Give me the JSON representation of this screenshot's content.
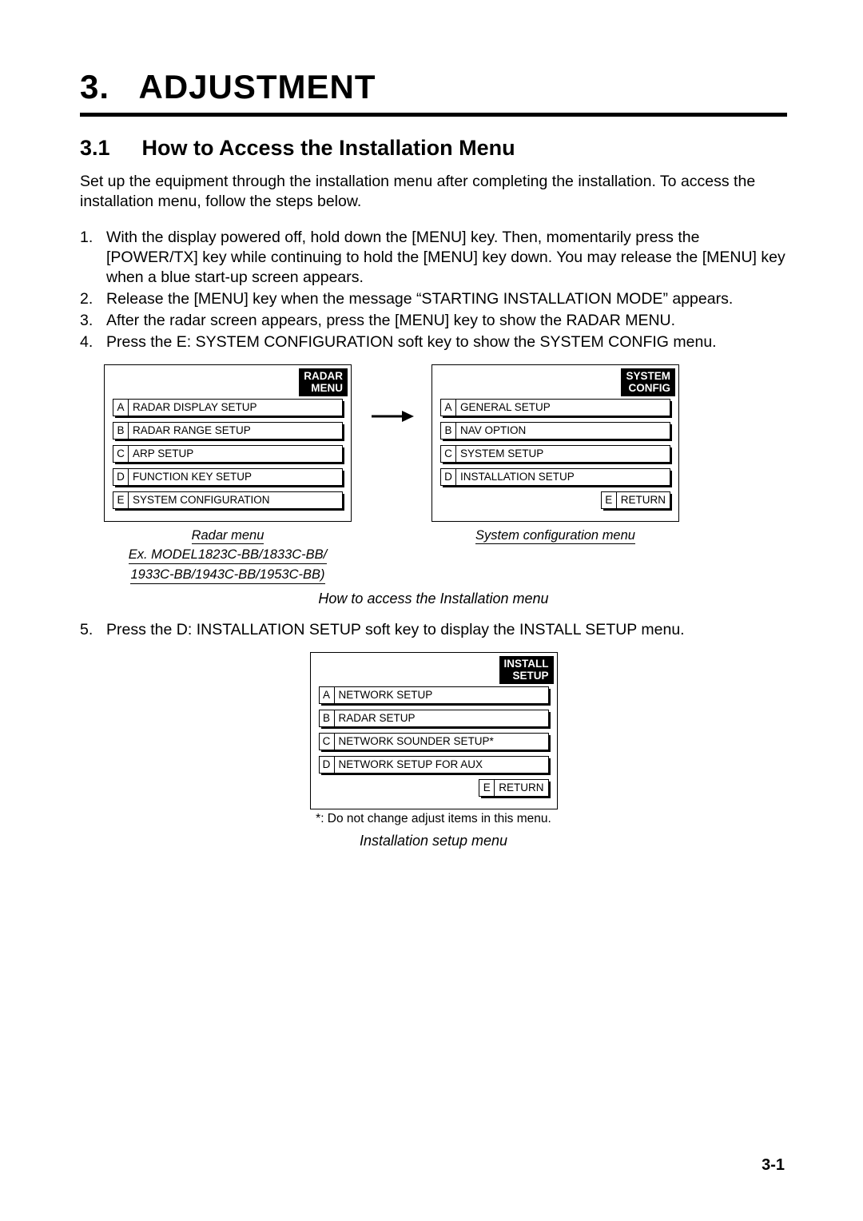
{
  "chapter": {
    "number": "3.",
    "title": "ADJUSTMENT"
  },
  "section": {
    "number": "3.1",
    "title": "How to Access the Installation Menu"
  },
  "intro": "Set up the equipment through the installation menu after completing the installation. To access the installation menu, follow the steps below.",
  "steps": [
    "With the display powered off, hold down the [MENU] key. Then, momentarily press the [POWER/TX] key while continuing to hold the [MENU] key down. You may release the [MENU] key when a blue start-up screen appears.",
    "Release the [MENU] key when the message “STARTING INSTALLATION MODE” appears.",
    "After the radar screen appears, press the [MENU] key to show the RADAR MENU.",
    "Press the E: SYSTEM CONFIGURATION soft key to show the SYSTEM CONFIG menu."
  ],
  "menu1": {
    "title1": "RADAR",
    "title2": "MENU",
    "items": [
      {
        "k": "A",
        "l": "RADAR DISPLAY SETUP"
      },
      {
        "k": "B",
        "l": "RADAR RANGE SETUP"
      },
      {
        "k": "C",
        "l": "ARP SETUP"
      },
      {
        "k": "D",
        "l": "FUNCTION KEY SETUP"
      },
      {
        "k": "E",
        "l": "SYSTEM CONFIGURATION"
      }
    ],
    "caption1": "Radar menu",
    "caption2": "Ex. MODEL1823C-BB/1833C-BB/",
    "caption3": "1933C-BB/1943C-BB/1953C-BB)"
  },
  "menu2": {
    "title1": "SYSTEM",
    "title2": "CONFIG",
    "items": [
      {
        "k": "A",
        "l": "GENERAL SETUP"
      },
      {
        "k": "B",
        "l": "NAV OPTION"
      },
      {
        "k": "C",
        "l": "SYSTEM SETUP"
      },
      {
        "k": "D",
        "l": "INSTALLATION SETUP"
      }
    ],
    "ret": {
      "k": "E",
      "l": "RETURN"
    },
    "caption": "System configuration menu"
  },
  "fig1_caption": "How to access the Installation menu",
  "step5": "Press the D: INSTALLATION SETUP soft key to display the INSTALL SETUP menu.",
  "menu3": {
    "title1": "INSTALL",
    "title2": "SETUP",
    "items": [
      {
        "k": "A",
        "l": "NETWORK SETUP"
      },
      {
        "k": "B",
        "l": "RADAR SETUP"
      },
      {
        "k": "C",
        "l": "NETWORK SOUNDER SETUP*"
      },
      {
        "k": "D",
        "l": "NETWORK SETUP FOR AUX"
      }
    ],
    "ret": {
      "k": "E",
      "l": "RETURN"
    }
  },
  "footnote": "*: Do not change adjust items in this menu.",
  "fig2_caption": "Installation setup menu",
  "page_num": "3-1"
}
